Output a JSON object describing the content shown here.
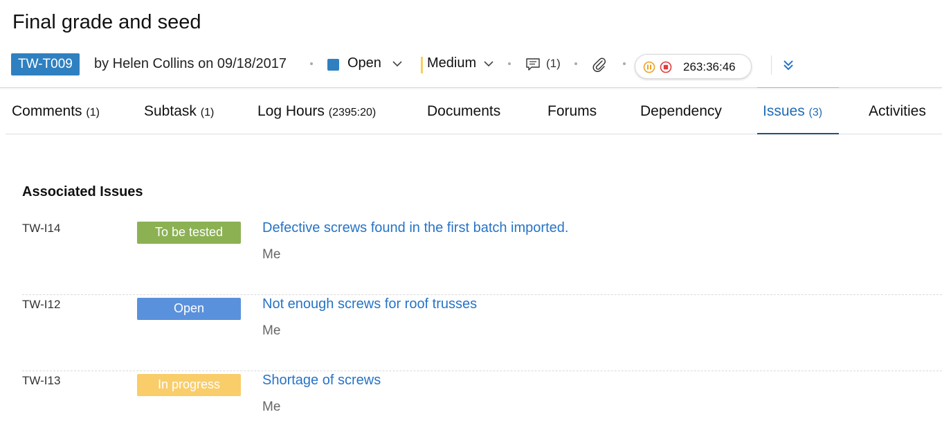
{
  "task": {
    "title": "Final grade and seed",
    "id": "TW-T009",
    "created_by": "by Helen Collins on 09/18/2017",
    "status": "Open",
    "status_color": "#2f80c0",
    "priority": "Medium",
    "priority_color": "#f5d15c",
    "comment_count": "(1)",
    "timer_value": "263:36:46"
  },
  "icons": {
    "status": "chevron-down-icon",
    "comment": "comment-icon",
    "attachment": "paperclip-icon",
    "pause": "pause-circle-icon",
    "stop": "stop-circle-icon",
    "expand": "double-chevron-down-icon"
  },
  "tabs": [
    {
      "label": "Comments",
      "count": "(1)"
    },
    {
      "label": "Subtask",
      "count": "(1)"
    },
    {
      "label": "Log Hours",
      "count": "(2395:20)"
    },
    {
      "label": "Documents",
      "count": ""
    },
    {
      "label": "Forums",
      "count": ""
    },
    {
      "label": "Dependency",
      "count": ""
    },
    {
      "label": "Issues",
      "count": "(3)"
    },
    {
      "label": "Activities",
      "count": ""
    }
  ],
  "active_tab": "Issues",
  "issues_section": {
    "title": "Associated Issues",
    "issues": [
      {
        "id": "TW-I14",
        "status": "To be tested",
        "status_color": "#8bb153",
        "title": "Defective screws found in the first batch imported.",
        "owner": "Me"
      },
      {
        "id": "TW-I12",
        "status": "Open",
        "status_color": "#5a91dc",
        "title": "Not enough screws for roof trusses",
        "owner": "Me"
      },
      {
        "id": "TW-I13",
        "status": "In progress",
        "status_color": "#f9cd6a",
        "title": "Shortage of screws",
        "owner": "Me"
      }
    ]
  }
}
